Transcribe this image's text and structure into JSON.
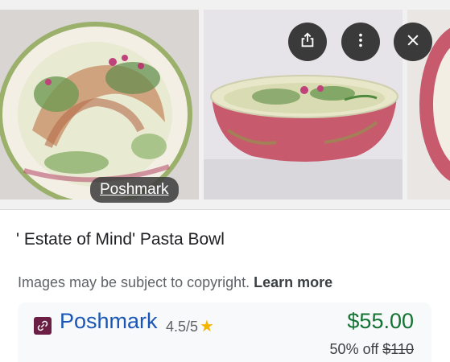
{
  "gallery": {
    "source_label": "Poshmark",
    "actions": {
      "share_icon": "share-icon",
      "more_icon": "more-vert-icon",
      "close_icon": "close-icon"
    }
  },
  "product": {
    "title": "' Estate of Mind' Pasta Bowl",
    "copyright_notice": "Images may be subject to copyright.",
    "learn_more": "Learn more"
  },
  "offer": {
    "merchant": "Poshmark",
    "rating": "4.5/5",
    "price": "$55.00",
    "discount_text": "50% off",
    "original_price": "$110"
  },
  "colors": {
    "price": "#137333",
    "merchant_link": "#1a56b8",
    "star": "#f4b400",
    "merchant_logo": "#6b1f45"
  }
}
